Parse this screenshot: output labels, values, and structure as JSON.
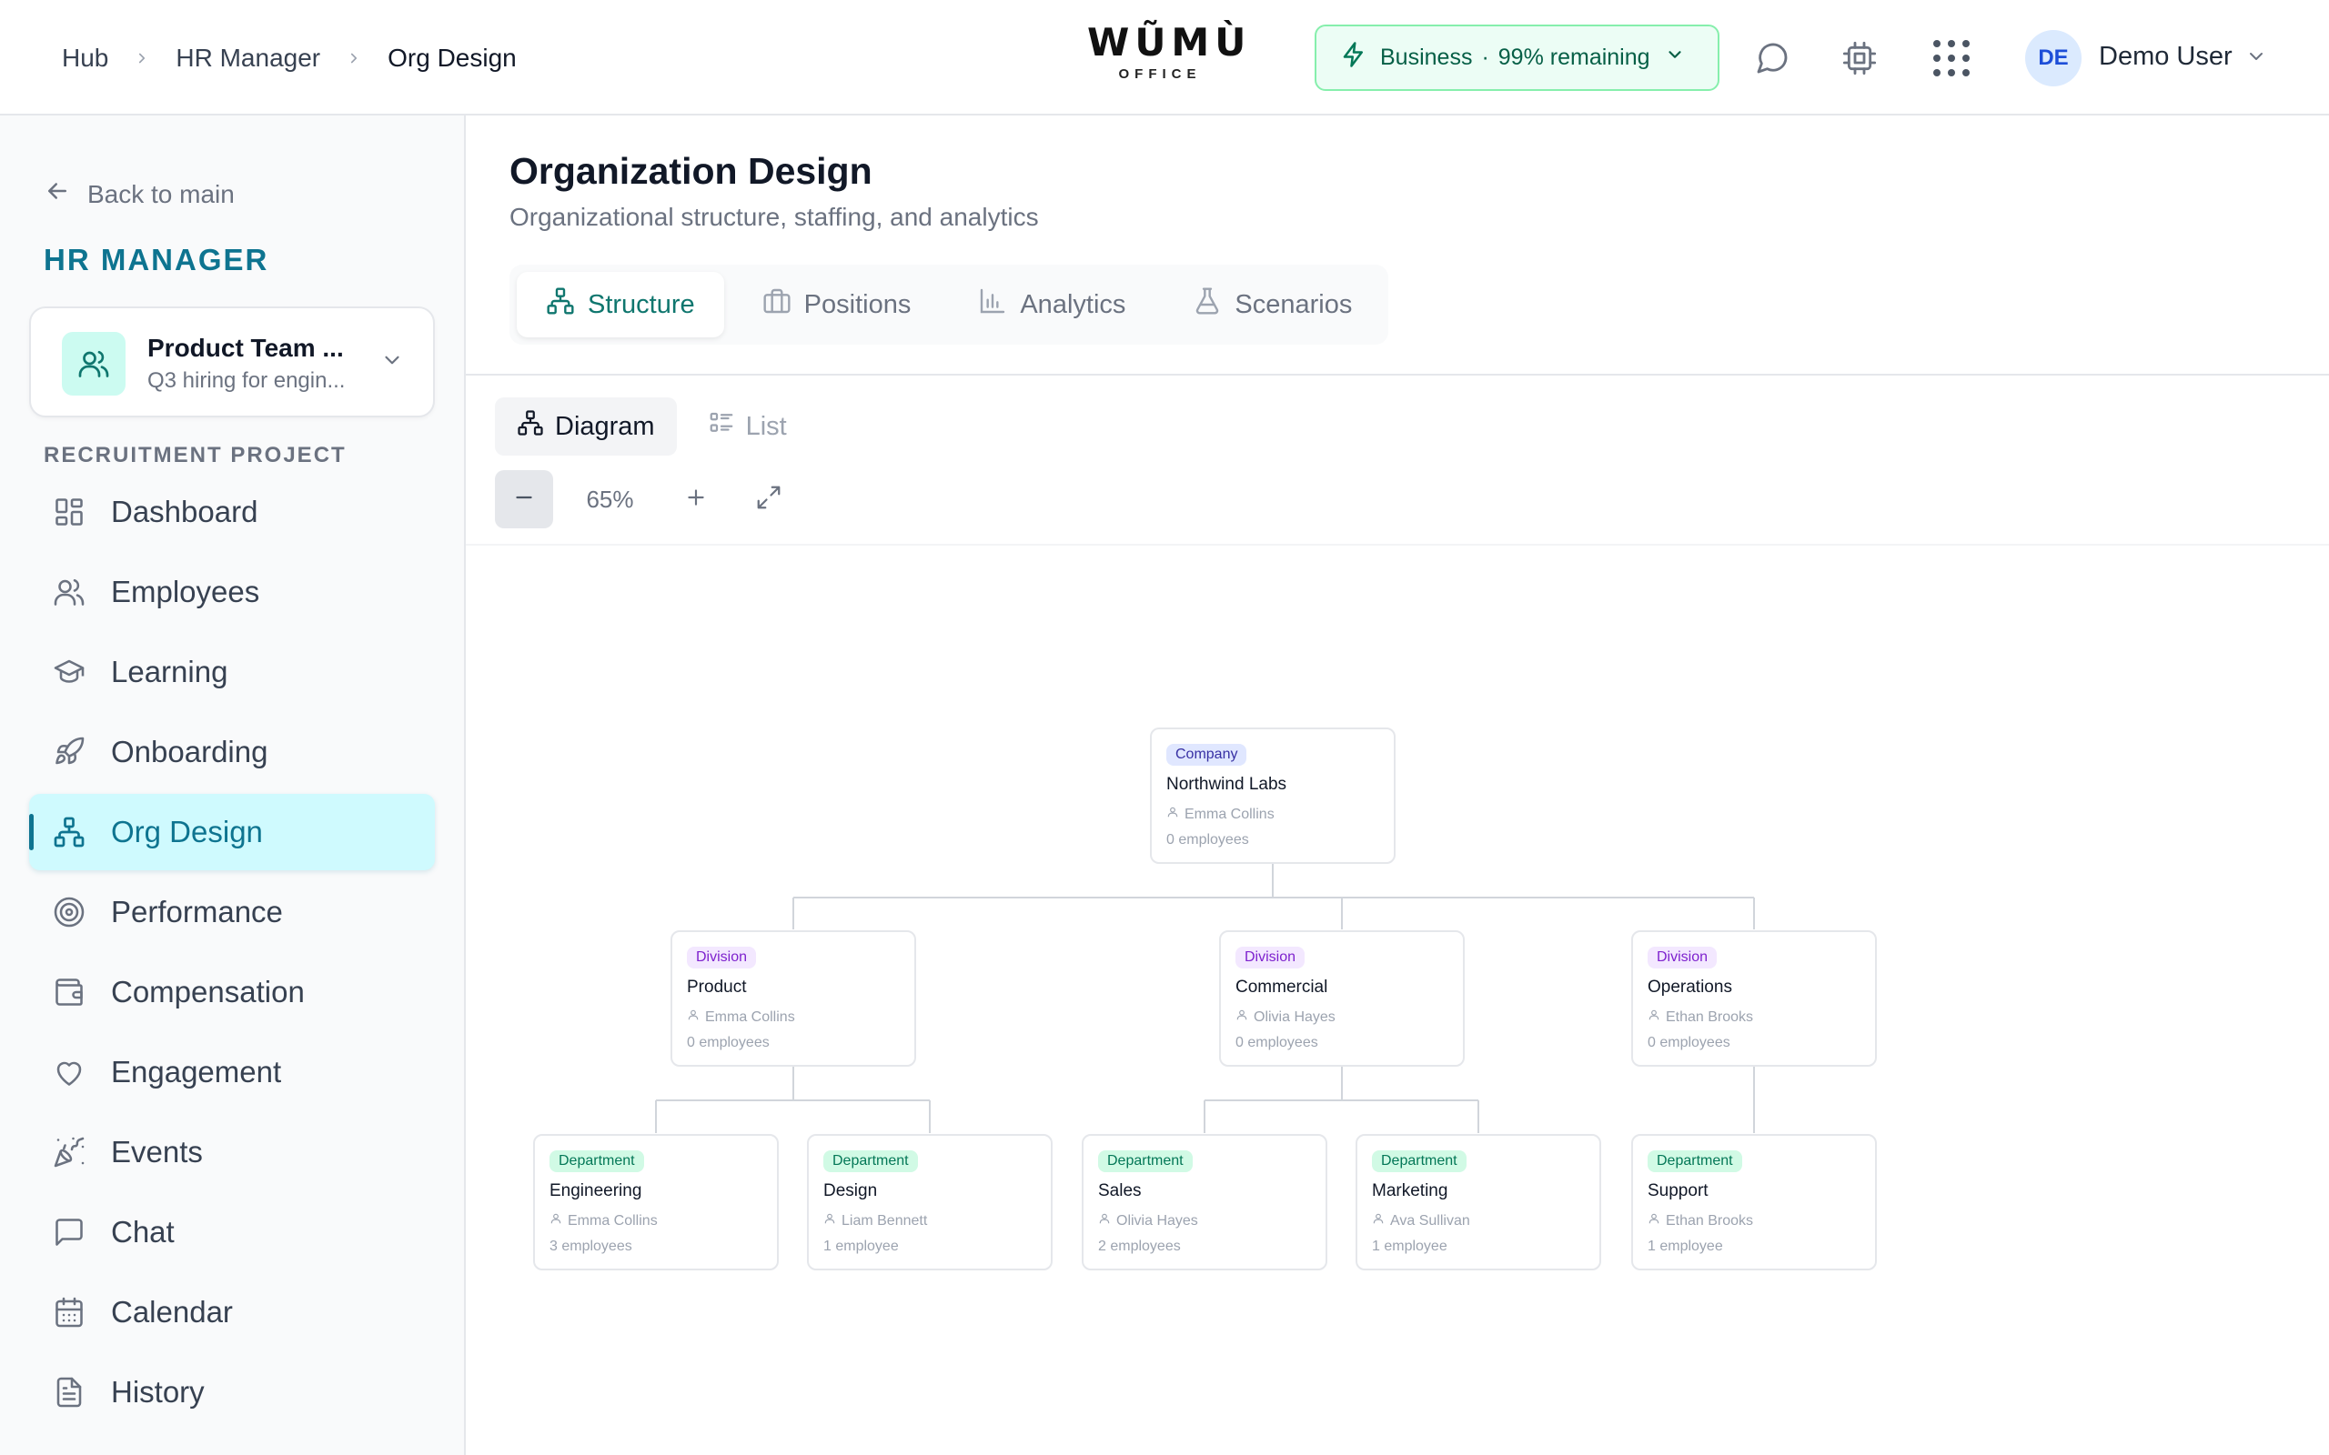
{
  "breadcrumbs": [
    "Hub",
    "HR Manager",
    "Org Design"
  ],
  "logo": {
    "word": "WŨMÙ",
    "sub": "OFFICE"
  },
  "plan": {
    "name": "Business",
    "separator": "·",
    "remaining": "99% remaining"
  },
  "user": {
    "initials": "DE",
    "name": "Demo User"
  },
  "sidebar": {
    "back_label": "Back to main",
    "title": "HR MANAGER",
    "project": {
      "name": "Product Team ...",
      "description": "Q3 hiring for engin..."
    },
    "section_label": "RECRUITMENT PROJECT",
    "items": [
      {
        "label": "Dashboard",
        "icon": "dashboard-icon"
      },
      {
        "label": "Employees",
        "icon": "users-icon"
      },
      {
        "label": "Learning",
        "icon": "graduation-cap-icon"
      },
      {
        "label": "Onboarding",
        "icon": "rocket-icon"
      },
      {
        "label": "Org Design",
        "icon": "org-chart-icon",
        "active": true
      },
      {
        "label": "Performance",
        "icon": "target-icon"
      },
      {
        "label": "Compensation",
        "icon": "wallet-icon"
      },
      {
        "label": "Engagement",
        "icon": "heart-icon"
      },
      {
        "label": "Events",
        "icon": "party-popper-icon"
      },
      {
        "label": "Chat",
        "icon": "message-square-icon"
      },
      {
        "label": "Calendar",
        "icon": "calendar-icon"
      },
      {
        "label": "History",
        "icon": "file-text-icon"
      }
    ]
  },
  "main": {
    "title": "Organization Design",
    "subtitle": "Organizational structure, staffing, and analytics",
    "tabs": [
      {
        "label": "Structure",
        "icon": "org-chart-icon",
        "active": true
      },
      {
        "label": "Positions",
        "icon": "briefcase-icon"
      },
      {
        "label": "Analytics",
        "icon": "bar-chart-icon"
      },
      {
        "label": "Scenarios",
        "icon": "flask-icon"
      }
    ],
    "view_toggle": [
      {
        "label": "Diagram",
        "icon": "org-chart-icon",
        "active": true
      },
      {
        "label": "List",
        "icon": "list-icon"
      }
    ],
    "zoom": "65%"
  },
  "org_chart": {
    "company": {
      "type": "Company",
      "name": "Northwind Labs",
      "lead": "Emma Collins",
      "count": "0 employees"
    },
    "divisions": [
      {
        "type": "Division",
        "name": "Product",
        "lead": "Emma Collins",
        "count": "0 employees"
      },
      {
        "type": "Division",
        "name": "Commercial",
        "lead": "Olivia Hayes",
        "count": "0 employees"
      },
      {
        "type": "Division",
        "name": "Operations",
        "lead": "Ethan Brooks",
        "count": "0 employees"
      }
    ],
    "departments": [
      {
        "type": "Department",
        "name": "Engineering",
        "lead": "Emma Collins",
        "count": "3 employees"
      },
      {
        "type": "Department",
        "name": "Design",
        "lead": "Liam Bennett",
        "count": "1 employee"
      },
      {
        "type": "Department",
        "name": "Sales",
        "lead": "Olivia Hayes",
        "count": "2 employees"
      },
      {
        "type": "Department",
        "name": "Marketing",
        "lead": "Ava Sullivan",
        "count": "1 employee"
      },
      {
        "type": "Department",
        "name": "Support",
        "lead": "Ethan Brooks",
        "count": "1 employee"
      }
    ]
  },
  "colors": {
    "accent": "#0e7490",
    "plan_bg": "#ecfdf5",
    "active_nav_bg": "#cffafe"
  }
}
